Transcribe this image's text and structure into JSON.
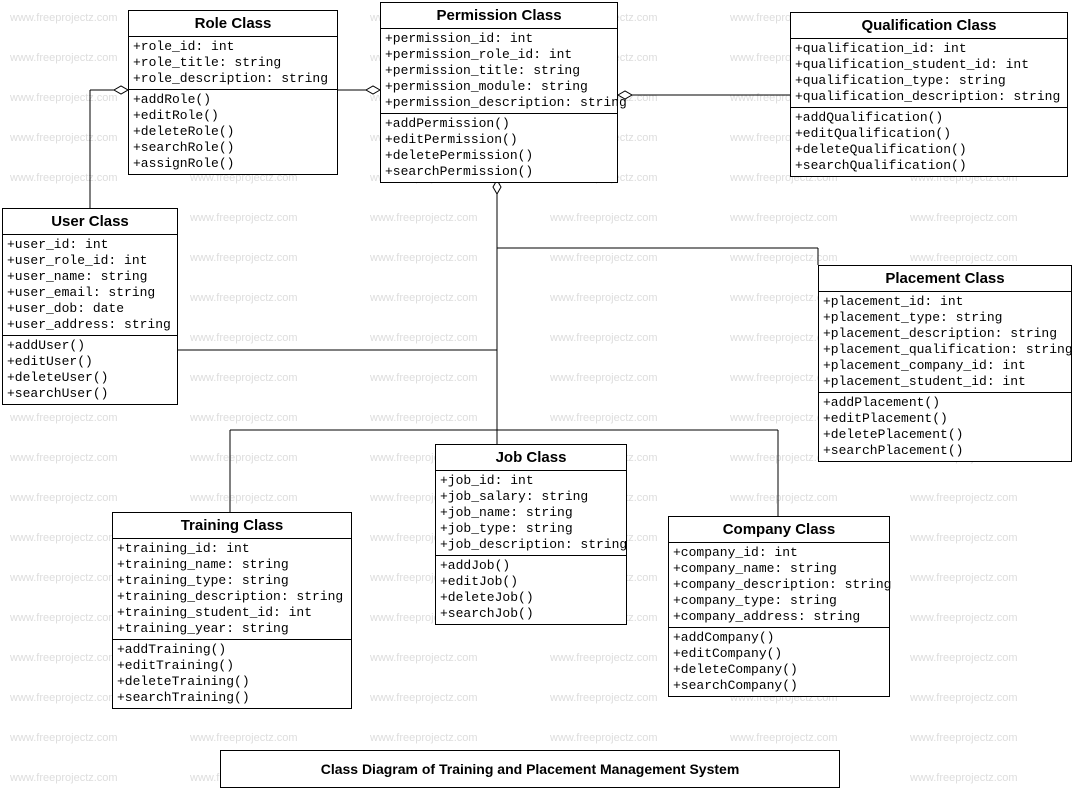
{
  "watermark_text": "www.freeprojectz.com",
  "caption": "Class Diagram of Training and Placement Management System",
  "classes": {
    "role": {
      "title": "Role Class",
      "attrs": [
        "+role_id: int",
        "+role_title: string",
        "+role_description: string"
      ],
      "ops": [
        "+addRole()",
        "+editRole()",
        "+deleteRole()",
        "+searchRole()",
        "+assignRole()"
      ]
    },
    "permission": {
      "title": "Permission Class",
      "attrs": [
        "+permission_id: int",
        "+permission_role_id: int",
        "+permission_title: string",
        "+permission_module: string",
        "+permission_description: string"
      ],
      "ops": [
        "+addPermission()",
        "+editPermission()",
        "+deletePermission()",
        "+searchPermission()"
      ]
    },
    "qualification": {
      "title": "Qualification Class",
      "attrs": [
        "+qualification_id: int",
        "+qualification_student_id: int",
        "+qualification_type: string",
        "+qualification_description: string"
      ],
      "ops": [
        "+addQualification()",
        "+editQualification()",
        "+deleteQualification()",
        "+searchQualification()"
      ]
    },
    "user": {
      "title": "User Class",
      "attrs": [
        "+user_id: int",
        "+user_role_id: int",
        "+user_name: string",
        "+user_email: string",
        "+user_dob: date",
        "+user_address: string"
      ],
      "ops": [
        "+addUser()",
        "+editUser()",
        "+deleteUser()",
        "+searchUser()"
      ]
    },
    "placement": {
      "title": "Placement Class",
      "attrs": [
        "+placement_id: int",
        "+placement_type: string",
        "+placement_description: string",
        "+placement_qualification: string",
        "+placement_company_id: int",
        "+placement_student_id: int"
      ],
      "ops": [
        "+addPlacement()",
        "+editPlacement()",
        "+deletePlacement()",
        "+searchPlacement()"
      ]
    },
    "job": {
      "title": "Job Class",
      "attrs": [
        "+job_id: int",
        "+job_salary: string",
        "+job_name: string",
        "+job_type: string",
        "+job_description: string"
      ],
      "ops": [
        "+addJob()",
        "+editJob()",
        "+deleteJob()",
        "+searchJob()"
      ]
    },
    "training": {
      "title": "Training Class",
      "attrs": [
        "+training_id: int",
        "+training_name: string",
        "+training_type: string",
        "+training_description: string",
        "+training_student_id: int",
        "+training_year: string"
      ],
      "ops": [
        "+addTraining()",
        "+editTraining()",
        "+deleteTraining()",
        "+searchTraining()"
      ]
    },
    "company": {
      "title": "Company Class",
      "attrs": [
        "+company_id: int",
        "+company_name: string",
        "+company_description: string",
        "+company_type: string",
        "+company_address: string"
      ],
      "ops": [
        "+addCompany()",
        "+editCompany()",
        "+deleteCompany()",
        "+searchCompany()"
      ]
    }
  }
}
